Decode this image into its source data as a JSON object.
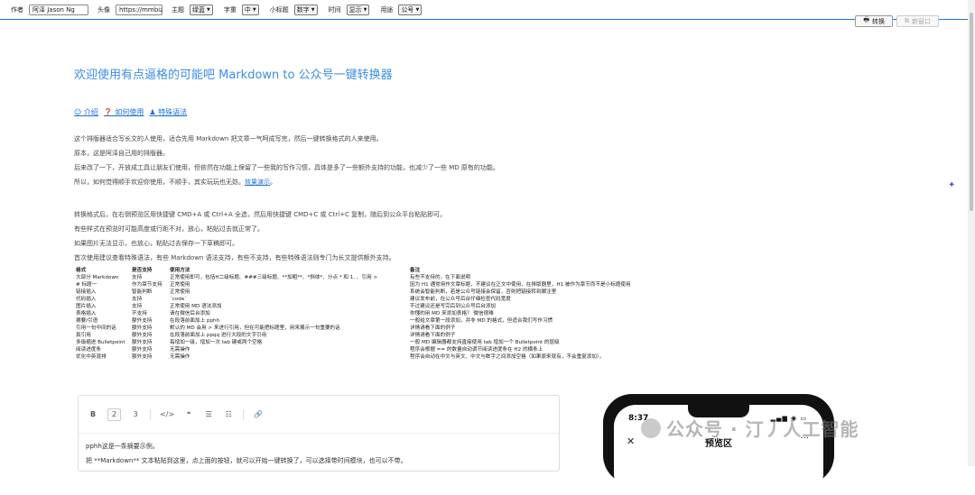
{
  "toolbar": {
    "author_label": "作者",
    "author_value": "阿泽 Jason Ng",
    "avatar_label": "头像",
    "avatar_value": "https://mmbiz.",
    "theme_label": "主题",
    "theme_value": "绿蓝",
    "fontsize_label": "字重",
    "fontsize_value": "中",
    "subtitle_label": "小标题",
    "subtitle_value": "数字",
    "time_label": "时间",
    "time_value": "显示",
    "use_label": "用途",
    "use_value": "公号",
    "convert_btn": "转换",
    "new_window_btn": "新窗口"
  },
  "doc": {
    "title": "欢迎使用有点逼格的可能吧 Markdown to 公众号一键转换器",
    "links": [
      "介绍",
      "如何使用",
      "特殊语法"
    ],
    "p1": "这个排版器适合写长文的人使用，适合先用 Markdown 把文章一气呵成写完，然后一键转换格式的人来使用。",
    "p2": "原本，这是阿泽自己用的排版器。",
    "p3": "后来改了一下，开放成工具让朋友们使用，但依然在功能上保留了一些我的写作习惯，具体是多了一些额外支持的功能，也减少了一些 MD 原有的功能。",
    "p4_pre": "所以，如何觉得顺手欢迎你使用，不顺手，其实玩玩也无妨。",
    "p4_link": "效果演示",
    "p4_post": "。",
    "q1": "转换格式后，在右侧预览区用快捷键 CMD+A 或 Ctrl+A 全选，然后用快捷键 CMD+C 或 Ctrl+C 复制，随后到公众平台粘贴即可。",
    "q2": "有些样式在预览时可能高度或行距不对，放心，粘贴过去就正常了。",
    "q3": "如果图片无法显示，也放心，粘贴过去保存一下草稿即可。",
    "q4": "首次使用建议查看特殊语法，有些 Markdown 语法支持，有些不支持，有些特殊语法则专门为长文提供额外支持。"
  },
  "table": {
    "headers": [
      "格式",
      "是否支持",
      "使用方法",
      "备注"
    ],
    "rows": [
      [
        "大部分 Markdown",
        "支持",
        "正常使用即可，包括H二级标题、###三级标题、**加粗**、*斜体*、分点 * 和 1. 、引用 >",
        "有些不支持的，在下面说明"
      ],
      [
        "# 标题一",
        "作为章节支持",
        "正常使用",
        "因为 H1 通常用作文章标题，不建议在正文中使用，在排版器里，H1 被作为章节而不是小标题使用"
      ],
      [
        "链接插入",
        "智能判断",
        "正常使用",
        "系统会智能判断，若是公众号链接会保留，否则把链接转到脚注里"
      ],
      [
        "代码插入",
        "支持",
        "`code`",
        "建议发布前，在公众号后台仔细检查代码宽度"
      ],
      [
        "图片插入",
        "支持",
        "正常使用 MD 语法添加",
        "不过建议还是写完后到公众号后台添加"
      ],
      [
        "表格插入",
        "不支持",
        "请在微信后台添加",
        "你懂的用 MD 来添加表格？ 微信很难"
      ],
      [
        "摘要/引语",
        "额外支持",
        "在段落前面加上 pphh",
        "一般给文章第一段添加，并非 MD 的格式，但适合我们写作习惯"
      ],
      [
        "引用一句中间的话",
        "额外支持",
        "默认的 MD 会用 > 来进行引用，但在可能把标题里，用来展示一句重要的话",
        "详情请看下面的例子"
      ],
      [
        "真引用",
        "额外支持",
        "在段落前面加上 ppqq 进行大段的文字引用",
        "详情请看下面的例子"
      ],
      [
        "多级缩进 Bulletpoint",
        "额外支持",
        "每增加一级，增加一次 tab 键或两个空格",
        "一般 MD 编辑器都支持直接使用 tab 增加一个 Bulletpoint 的层级"
      ],
      [
        "阅读进度条",
        "额外支持",
        "无需操作",
        "程序会根据 == 的数量自动调节阅读进度条在 H2 的横条上"
      ],
      [
        "优化中英混排",
        "额外支持",
        "无需操作",
        "程序会自动在中文与英文、中文与数字之间添加空格（如果原来就有，不会重复添加）。"
      ]
    ]
  },
  "editor": {
    "tools": [
      "B",
      "2",
      "3",
      "</>",
      "❝",
      "☰",
      "☷",
      "🔗"
    ],
    "line1": "pphh这是一条摘要示例。",
    "line2": "把 **Markdown** 文本粘贴到这里，点上面的按钮，就可以开始一键转换了，可以选择带时间模块，也可以不带。"
  },
  "phone": {
    "time": "8:37",
    "title": "预览区",
    "close": "✕",
    "more": "···"
  },
  "watermark": "公众号 · 汀丿人工智能",
  "colors": {
    "accent": "#1e6fd9",
    "title": "#3a8ee6"
  }
}
